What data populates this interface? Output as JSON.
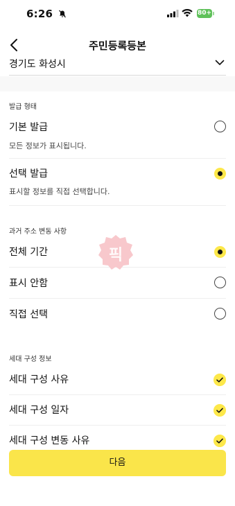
{
  "status_bar": {
    "time": "6:26",
    "battery": "80+"
  },
  "header": {
    "title": "주민등록등본"
  },
  "region": {
    "value": "경기도 화성시"
  },
  "issue_type": {
    "label": "발급 형태",
    "options": [
      {
        "label": "기본 발급",
        "description": "모든 정보가 표시됩니다.",
        "selected": false
      },
      {
        "label": "선택 발급",
        "description": "표시할 정보를 직접 선택합니다.",
        "selected": true
      }
    ]
  },
  "past_address": {
    "label": "과거 주소 변동 사항",
    "options": [
      {
        "label": "전체 기간",
        "selected": true
      },
      {
        "label": "표시 안함",
        "selected": false
      },
      {
        "label": "직접 선택",
        "selected": false
      }
    ]
  },
  "household": {
    "label": "세대 구성 정보",
    "options": [
      {
        "label": "세대 구성 사유",
        "checked": true
      },
      {
        "label": "세대 구성 일자",
        "checked": true
      },
      {
        "label": "세대 구성 변동 사유",
        "checked": true
      }
    ]
  },
  "watermark": {
    "text": "픽"
  },
  "footer": {
    "next_label": "다음"
  },
  "colors": {
    "accent": "#fde84a",
    "button": "#fae54a",
    "battery": "#5fc15a",
    "watermark": "#f8c8cc"
  }
}
